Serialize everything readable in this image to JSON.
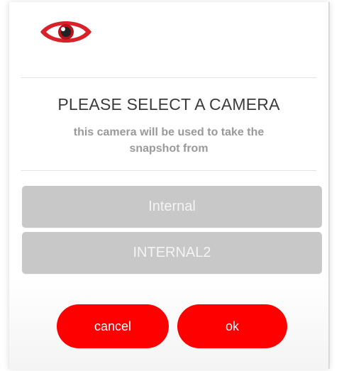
{
  "header": {
    "icon": "eye-icon",
    "accent_color": "#ff0000"
  },
  "dialog": {
    "title": "PLEASE SELECT A CAMERA",
    "subtitle": "this camera will be used to take the snapshot from"
  },
  "cameras": [
    {
      "label": "Internal"
    },
    {
      "label": "INTERNAL2"
    }
  ],
  "actions": {
    "cancel_label": "cancel",
    "ok_label": "ok"
  }
}
